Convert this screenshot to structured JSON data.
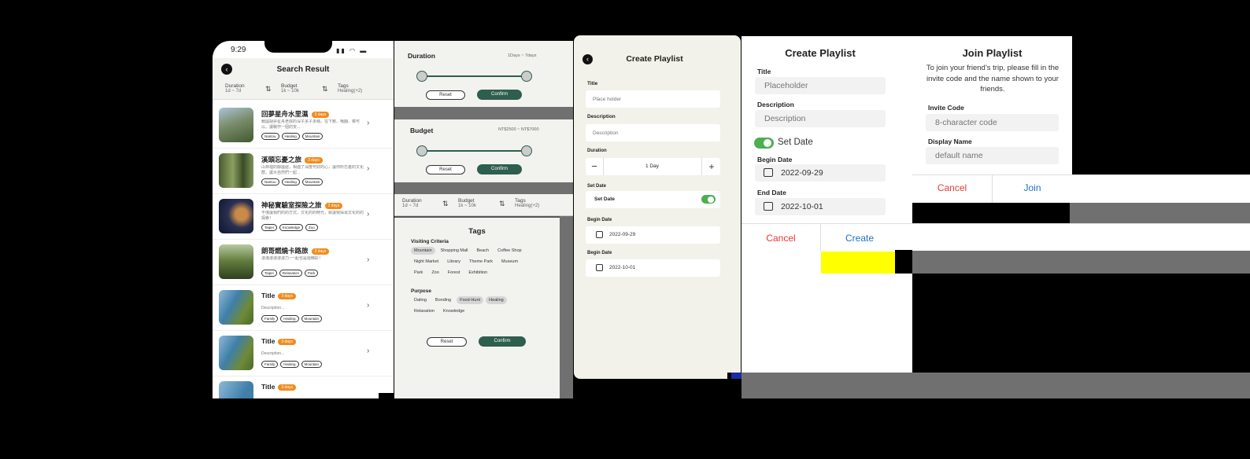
{
  "search": {
    "time": "9:29",
    "title": "Search Result",
    "filters": [
      {
        "label": "Duration",
        "value": "1d ~ 7d"
      },
      {
        "label": "Budget",
        "value": "1k ~ 10k"
      },
      {
        "label": "Tags",
        "value": "Healing(+2)"
      }
    ],
    "items": [
      {
        "title": "回夢星舟水里濕",
        "badge": "3 days",
        "desc": "戰國胡夢星舟老院的深子多子多條。在下數、哦翻、菜可以。讓戰作一個的安...",
        "tags": [
          "Nantou",
          "Healing",
          "Mountain"
        ]
      },
      {
        "title": "溪頭忘憂之旅",
        "badge": "3 days",
        "desc": "山林裡的靜謐處，相遇了深度可好的心，讓你所忘憂的文化群。讓大自然們一起...",
        "tags": [
          "Nantou",
          "Healing",
          "Mountain"
        ]
      },
      {
        "title": "神秘實驗室探險之旅",
        "badge": "2 days",
        "desc": "不僅讓我們的的方式，文化的的時光，就讓我探尋文化的的探索！",
        "tags": [
          "Taipei",
          "Knowledge",
          "Zoo"
        ]
      },
      {
        "title": "朗哥燃燒卡路旅",
        "badge": "3 days",
        "desc": "漫滿漫漫漫漫力~一起也是很精彩！",
        "tags": [
          "Taipei",
          "Relaxation",
          "Park"
        ]
      },
      {
        "title": "Title",
        "badge": "3 days",
        "desc": "Description...",
        "tags": [
          "Family",
          "Healing",
          "Mountain"
        ]
      },
      {
        "title": "Title",
        "badge": "3 days",
        "desc": "Description...",
        "tags": [
          "Family",
          "Healing",
          "Mountain"
        ]
      },
      {
        "title": "Title",
        "badge": "3 days",
        "desc": "",
        "tags": []
      }
    ]
  },
  "filters_panel": {
    "duration_label": "Duration",
    "duration_range": "1Days ~ 7days",
    "budget_label": "Budget",
    "budget_range": "NT$2500 ~ NT$7000",
    "reset": "Reset",
    "confirm": "Confirm",
    "bar": [
      {
        "label": "Duration",
        "value": "1d ~ 7d"
      },
      {
        "label": "Budget",
        "value": "1k ~ 10k"
      },
      {
        "label": "Tags",
        "value": "Healing(+2)"
      }
    ],
    "tags_title": "Tags",
    "visiting_label": "Visiting Criteria",
    "visiting": [
      [
        {
          "t": "Mountain",
          "sel": true
        },
        {
          "t": "Shopping Mall"
        },
        {
          "t": "Beach"
        },
        {
          "t": "Coffee Shop"
        }
      ],
      [
        {
          "t": "Night Market"
        },
        {
          "t": "Library"
        },
        {
          "t": "Theme Park"
        },
        {
          "t": "Museum"
        }
      ],
      [
        {
          "t": "Park"
        },
        {
          "t": "Zoo"
        },
        {
          "t": "Forest"
        },
        {
          "t": "Exhibition"
        }
      ]
    ],
    "purpose_label": "Purpose",
    "purpose": [
      [
        {
          "t": "Dating"
        },
        {
          "t": "Bonding"
        },
        {
          "t": "Food-Hunt",
          "sel": true
        },
        {
          "t": "Healing",
          "sel": true
        }
      ],
      [
        {
          "t": "Relaxation"
        },
        {
          "t": "Knowledge"
        }
      ]
    ]
  },
  "create_form": {
    "title": "Create Playlist",
    "title_label": "Title",
    "title_ph": "Place holder",
    "desc_label": "Description",
    "desc_ph": "Description",
    "duration_label": "Duration",
    "duration_value": "1 Day",
    "setdate_section": "Set Date",
    "setdate_toggle_label": "Set Date",
    "begin_label": "Begin Date",
    "begin_value": "2022-09-29",
    "end_label": "Begin Date",
    "end_value": "2022-10-01",
    "toggle_color": "#4caf50"
  },
  "create_dialog": {
    "title": "Create Playlist",
    "title_label": "Title",
    "title_ph": "Placeholder",
    "desc_label": "Description",
    "desc_ph": "Description",
    "setdate": "Set Date",
    "begin_label": "Begin Date",
    "begin_value": "2022-09-29",
    "end_label": "End Date",
    "end_value": "2022-10-01",
    "cancel": "Cancel",
    "create": "Create",
    "cancel_color": "#e53935",
    "create_color": "#1e6fc8"
  },
  "join_dialog": {
    "title": "Join Playlist",
    "desc": "To join your friend’s trip, please fill in the invite code and the name shown to your friends.",
    "code_label": "Invite Code",
    "code_ph": "8-character code",
    "name_label": "Display Name",
    "name_ph": "default name",
    "cancel": "Cancel",
    "join": "Join"
  }
}
